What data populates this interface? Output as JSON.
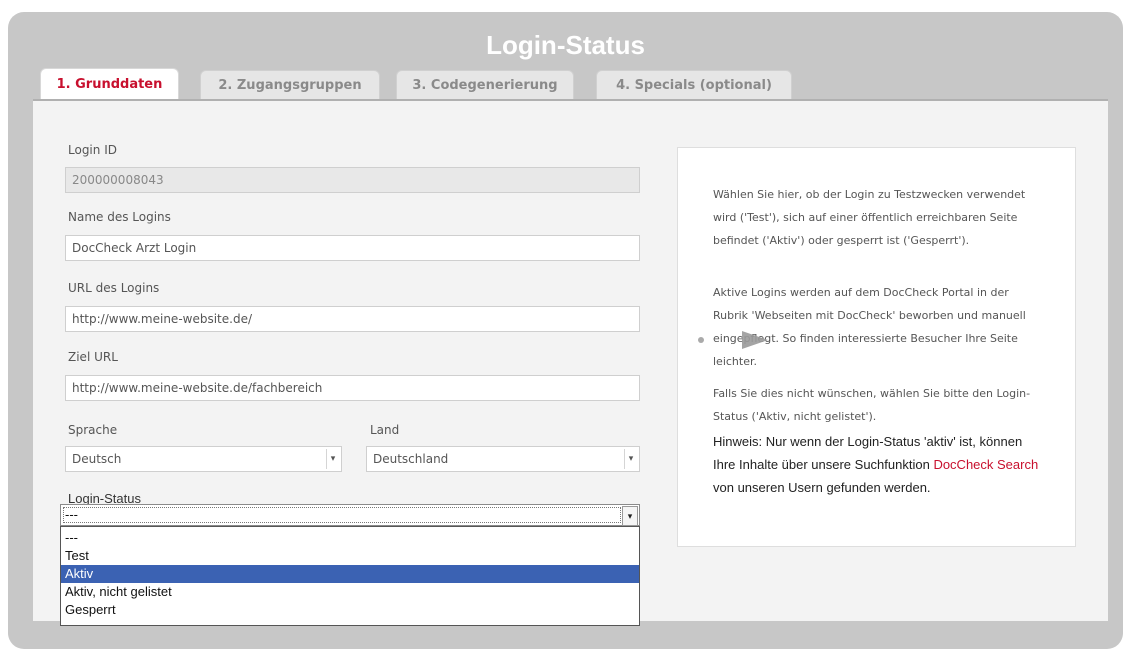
{
  "window": {
    "title": "Login-Status"
  },
  "tabs": [
    {
      "label": "1. Grunddaten",
      "active": true
    },
    {
      "label": "2. Zugangsgruppen",
      "active": false
    },
    {
      "label": "3. Codegenerierung",
      "active": false
    },
    {
      "label": "4. Specials (optional)",
      "active": false
    }
  ],
  "form": {
    "login_id": {
      "label": "Login ID",
      "value": "200000008043"
    },
    "name": {
      "label": "Name des Logins",
      "value": "DocCheck Arzt Login"
    },
    "url": {
      "label": "URL des Logins",
      "value": "http://www.meine-website.de/"
    },
    "target_url": {
      "label": "Ziel URL",
      "value": "http://www.meine-website.de/fachbereich"
    },
    "language": {
      "label": "Sprache",
      "value": "Deutsch"
    },
    "country": {
      "label": "Land",
      "value": "Deutschland"
    },
    "login_status": {
      "label": "Login-Status",
      "value": "---",
      "options": [
        "---",
        "Test",
        "Aktiv",
        "Aktiv, nicht gelistet",
        "Gesperrt"
      ],
      "highlighted": "Aktiv"
    }
  },
  "help": {
    "p1": "Wählen Sie hier, ob der Login zu Testzwecken verwendet wird ('Test'), sich auf einer öffentlich erreichbaren Seite befindet ('Aktiv') oder gesperrt ist ('Gesperrt').",
    "p2": "Aktive Logins werden auf dem DocCheck Portal in der Rubrik 'Webseiten mit DocCheck' beworben und manuell eingepflegt. So finden interessierte Besucher Ihre Seite leichter.",
    "p3": "Falls Sie dies nicht wünschen, wählen Sie bitte den Login-Status ('Aktiv, nicht gelistet').",
    "p4_before": "Hinweis: Nur wenn der Login-Status 'aktiv' ist, können Ihre Inhalte über unsere Suchfunktion ",
    "p4_link": "DocCheck Search",
    "p4_after": " von unseren Usern gefunden werden."
  },
  "colors": {
    "accent": "#c8102e",
    "selection": "#3b62b3",
    "frame": "#c7c7c7"
  }
}
